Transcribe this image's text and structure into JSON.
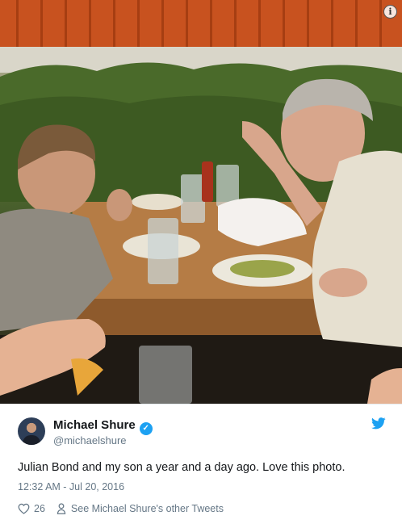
{
  "photo": {
    "alt_description": "",
    "info_icon": "info-icon"
  },
  "tweet": {
    "author": {
      "display_name": "Michael Shure",
      "handle": "@michaelshure",
      "verified": true
    },
    "text": "Julian Bond and my son a year and a day ago. Love this photo.",
    "timestamp": "12:32 AM - Jul 20, 2016",
    "likes": "26",
    "profile_link": "See Michael Shure's other Tweets",
    "colors": {
      "accent": "#1da1f2",
      "heart": "#657786",
      "secondary": "#657786"
    }
  }
}
